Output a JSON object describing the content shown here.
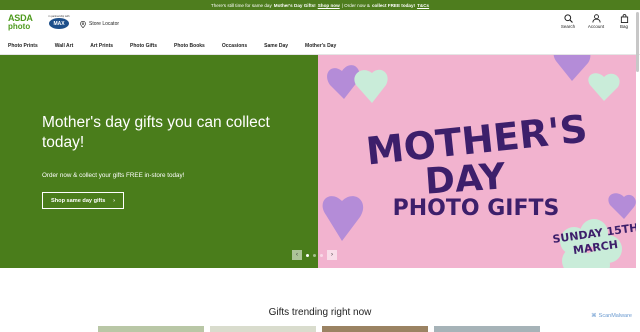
{
  "announcement": {
    "prefix": "There's still time for same day",
    "highlight": "Mother's Day Gifts!",
    "shop_link": "Shop now",
    "middle": "| Order now &",
    "collect": "collect FREE today!",
    "tcs_link": "T&Cs"
  },
  "header": {
    "logo_line1": "ASDA",
    "logo_line2": "photo",
    "partner_text": "in partnership with",
    "partner_badge": "MAX",
    "store_locator": "Store Locator",
    "actions": [
      {
        "label": "Search",
        "icon": "search-icon"
      },
      {
        "label": "Account",
        "icon": "account-icon"
      },
      {
        "label": "Bag",
        "icon": "bag-icon"
      }
    ]
  },
  "nav": {
    "items": [
      "Photo Prints",
      "Wall Art",
      "Art Prints",
      "Photo Gifts",
      "Photo Books",
      "Occasions",
      "Same Day",
      "Mother's Day"
    ]
  },
  "hero": {
    "title": "Mother's day gifts you can collect today!",
    "subtitle": "Order now & collect your gifts FREE in-store today!",
    "button_label": "Shop same day gifts",
    "button_arrow": "›",
    "banner_line1": "MOTHER'S",
    "banner_line2": "DAY",
    "banner_line3": "PHOTO GIFTS",
    "date_line1": "SUNDAY 15TH",
    "date_line2": "MARCH",
    "prev_arrow": "‹",
    "next_arrow": "›",
    "colors": {
      "green": "#4a7d1b",
      "pink": "#f2b3cf",
      "purple": "#3d1f6b",
      "lavender": "#b48cd8",
      "mint": "#c9ecd9"
    }
  },
  "trending": {
    "heading": "Gifts trending right now"
  },
  "watermark": "ScanMalware"
}
